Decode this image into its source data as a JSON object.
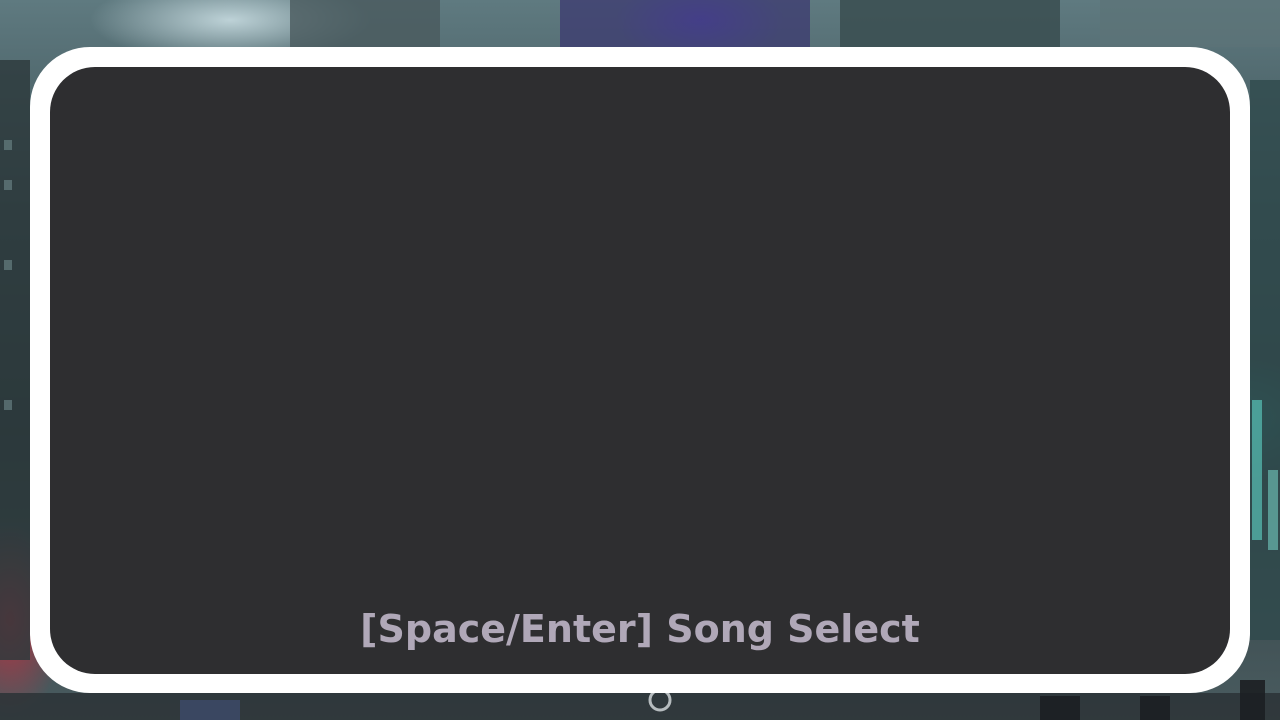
{
  "screen": {
    "prompt_text": "[Space/Enter] Song Select"
  },
  "colors": {
    "frame": "#ffffff",
    "panel": "#2e2e30",
    "prompt_text": "#b0a8b8"
  }
}
